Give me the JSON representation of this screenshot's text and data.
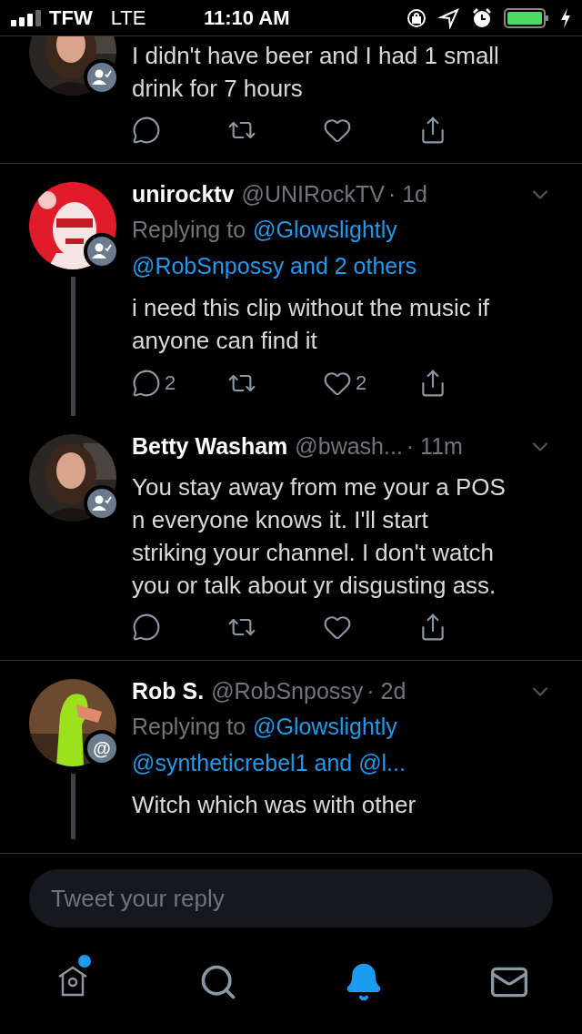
{
  "status_bar": {
    "carrier": "TFW",
    "network": "LTE",
    "time": "11:10 AM"
  },
  "tweets": [
    {
      "badge": {
        "kind": "follow"
      },
      "thread_line": false,
      "body": "I didn't have beer and I had 1 small drink for 7 hours",
      "actions": [
        {
          "kind": "reply"
        },
        {
          "kind": "retweet"
        },
        {
          "kind": "like"
        },
        {
          "kind": "share"
        }
      ]
    },
    {
      "badge": {
        "kind": "follow"
      },
      "thread_line": true,
      "name": "unirocktv",
      "handle": "@UNIRockTV",
      "time": "· 1d",
      "menu": true,
      "replying": {
        "label": "Replying to",
        "first": "@Glowslightly",
        "rest": "@RobSnpossy and 2 others"
      },
      "body": "i need this clip without the music if anyone can find it",
      "actions": [
        {
          "kind": "reply",
          "count": "2"
        },
        {
          "kind": "retweet"
        },
        {
          "kind": "like",
          "count": "2"
        },
        {
          "kind": "share"
        }
      ]
    },
    {
      "badge": {
        "kind": "follow"
      },
      "thread_line": false,
      "name": "Betty Washam",
      "handle": "@bwash...",
      "time": "· 11m",
      "menu": true,
      "body": "You stay away from me your a POS n everyone knows it. I'll start striking your channel. I don't watch you or talk about yr disgusting ass.",
      "actions": [
        {
          "kind": "reply"
        },
        {
          "kind": "retweet"
        },
        {
          "kind": "like"
        },
        {
          "kind": "share"
        }
      ]
    },
    {
      "badge": {
        "kind": "mention",
        "text": "@"
      },
      "thread_line": true,
      "name": "Rob S.",
      "handle": "@RobSnpossy",
      "time": "· 2d",
      "menu": true,
      "replying": {
        "label": "Replying to",
        "first": "@Glowslightly",
        "rest": "@syntheticrebel1 and @l..."
      },
      "body": "Witch which was with other"
    }
  ],
  "reply_box": {
    "placeholder": "Tweet your reply"
  },
  "tab_bar": [
    {
      "kind": "home",
      "selected": false,
      "dot": true
    },
    {
      "kind": "search",
      "selected": false,
      "dot": false
    },
    {
      "kind": "notifications",
      "selected": true,
      "dot": false
    },
    {
      "kind": "messages",
      "selected": false,
      "dot": false
    }
  ]
}
